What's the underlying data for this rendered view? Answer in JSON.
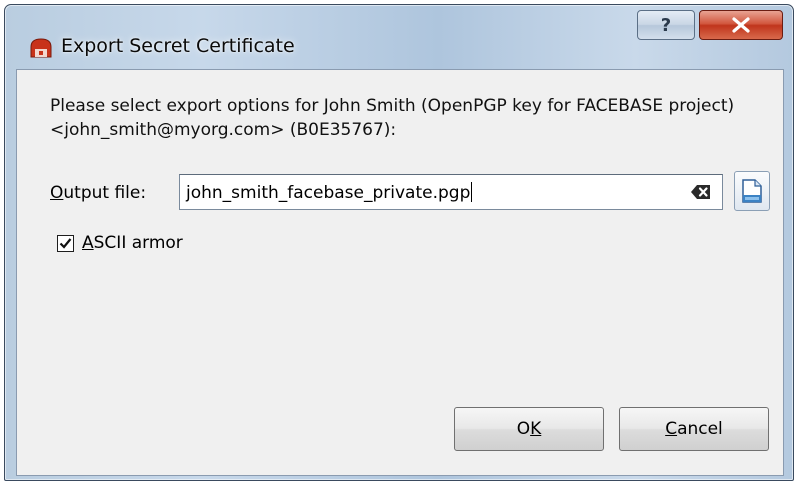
{
  "window": {
    "title": "Export Secret Certificate",
    "help_label": "?",
    "close_label": "X"
  },
  "message": "Please select export options for John Smith (OpenPGP key for FACEBASE project) <john_smith@myorg.com> (B0E35767):",
  "output_file": {
    "label_first": "O",
    "label_rest": "utput file:",
    "value": "john_smith_facebase_private.pgp"
  },
  "armor": {
    "checked": true,
    "label_first": "A",
    "label_rest": "SCII armor"
  },
  "buttons": {
    "ok_pre": "O",
    "ok_accel": "K",
    "cancel_accel": "C",
    "cancel_rest": "ancel"
  },
  "colors": {
    "app_icon": "#c8321a",
    "close_button": "#c0351c",
    "dialog_background": "#f0f0f0"
  }
}
